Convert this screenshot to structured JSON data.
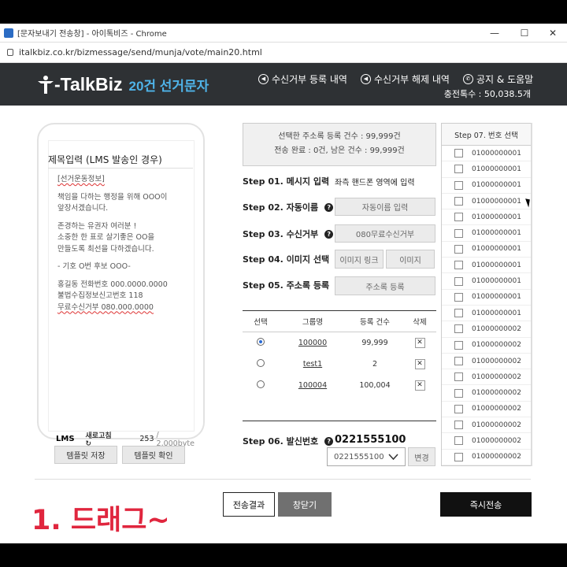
{
  "window": {
    "title": "[문자보내기 전송창] - 아이톡비즈 - Chrome",
    "url": "italkbiz.co.kr/bizmessage/send/munja/vote/main20.html"
  },
  "header": {
    "logo": "-TalkBiz",
    "logo_sub": "20건 선거문자",
    "nav": [
      "수신거부 등록 내역",
      "수신거부 해제 내역",
      "공지 & 도움말"
    ],
    "charge": "충전톡수 : 50,038.5개"
  },
  "phone": {
    "title": "제목입력 (LMS 발송인 경우)",
    "lines": [
      "[선거운동정보]",
      "",
      "책임을 다하는 행정을 위해 OOO이",
      "앞장서겠습니다.",
      "",
      "존경하는 유권자 여러분 !",
      "소중한 한 표로 살기좋은 OO을",
      "만들도록 최선을 다하겠습니다.",
      "",
      "- 기호 O번 후보 OOO-",
      "",
      "홍길동 전화번호 000.0000.0000",
      "불법수집정보신고번호 118",
      "무료수신거부 080.000.0000"
    ],
    "mode": "LMS",
    "refresh": "새로고침",
    "bytes_used": "253",
    "bytes_max": "/ 2,000byte"
  },
  "template": {
    "save": "템플릿 저장",
    "check": "템플릿 확인"
  },
  "summary": {
    "line1": "선택한 주소록 등록 건수 : 99,999건",
    "line2": "전송 완료 : 0건, 남은 건수 : 99,999건"
  },
  "steps": {
    "s1": "Step 01. 메시지 입력",
    "s1_desc": "좌측 핸드폰 영역에 입력",
    "s2": "Step 02. 자동이름",
    "s2_btn": "자동이름 입력",
    "s3": "Step 03. 수신거부",
    "s3_btn": "080무료수신거부",
    "s4": "Step 04. 이미지 선택",
    "s4_btn1": "이미지 링크",
    "s4_btn2": "이미지",
    "s5": "Step 05. 주소록 등록",
    "s5_btn": "주소록 등록",
    "s6": "Step 06. 발신번호",
    "s7": "Step 07. 번호 선택"
  },
  "groups": {
    "headers": [
      "선택",
      "그룹명",
      "등록 건수",
      "삭제"
    ],
    "rows": [
      {
        "name": "100000",
        "count": "99,999",
        "selected": true
      },
      {
        "name": "test1",
        "count": "2",
        "selected": false
      },
      {
        "name": "100004",
        "count": "100,004",
        "selected": false
      }
    ],
    "delete_label": "✕"
  },
  "sender": {
    "number": "0221555100",
    "select_value": "0221555100",
    "change": "변경"
  },
  "numbers": [
    "01000000001",
    "01000000001",
    "01000000001",
    "01000000001",
    "01000000001",
    "01000000001",
    "01000000001",
    "01000000001",
    "01000000001",
    "01000000001",
    "01000000001",
    "01000000002",
    "01000000002",
    "01000000002",
    "01000000002",
    "01000000002",
    "01000000002",
    "01000000002",
    "01000000002",
    "01000000002"
  ],
  "footer": {
    "result": "전송결과",
    "close": "창닫기",
    "send": "즉시전송"
  },
  "overlay": {
    "caption": "1. 드래그~"
  }
}
